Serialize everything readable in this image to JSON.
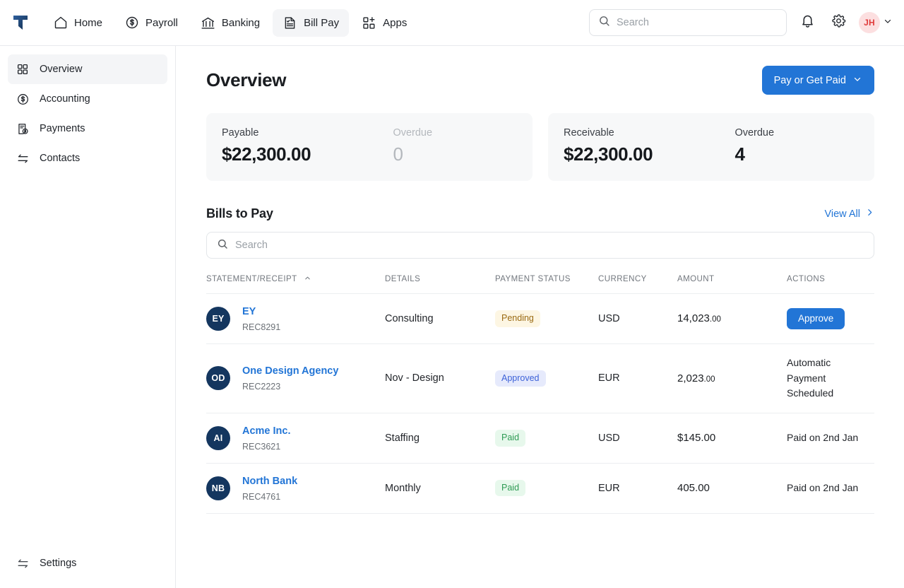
{
  "brand": {
    "logo_alt": "T",
    "primary_color": "#2275d6",
    "logo_color": "#1b3d6b"
  },
  "topnav": {
    "items": [
      {
        "label": "Home",
        "icon": "home-icon",
        "active": false
      },
      {
        "label": "Payroll",
        "icon": "dollar-circle-icon",
        "active": false
      },
      {
        "label": "Banking",
        "icon": "bank-icon",
        "active": false
      },
      {
        "label": "Bill Pay",
        "icon": "document-check-icon",
        "active": true
      },
      {
        "label": "Apps",
        "icon": "apps-plus-icon",
        "active": false
      }
    ],
    "search": {
      "value": "",
      "placeholder": "Search",
      "icon": "search-icon"
    },
    "notifications_icon": "bell-icon",
    "settings_icon": "gear-icon",
    "avatar": {
      "initials": "JH",
      "bg": "#fcdfe0",
      "fg": "#e03b3b",
      "chevron": "chevron-down-icon"
    }
  },
  "sidebar": {
    "items": [
      {
        "label": "Overview",
        "icon": "grid-icon",
        "active": true
      },
      {
        "label": "Accounting",
        "icon": "dollar-circle-icon",
        "active": false
      },
      {
        "label": "Payments",
        "icon": "receipt-dollar-icon",
        "active": false
      },
      {
        "label": "Contacts",
        "icon": "transfer-icon",
        "active": false
      }
    ],
    "bottom": {
      "label": "Settings",
      "icon": "transfer-icon"
    }
  },
  "page": {
    "title": "Overview",
    "primary_action": {
      "label": "Pay or Get Paid",
      "chevron": "chevron-down-icon"
    }
  },
  "cards": [
    {
      "primary_label": "Payable",
      "primary_value": "$22,300.00",
      "secondary_label": "Overdue",
      "secondary_value": "0",
      "secondary_dim": true
    },
    {
      "primary_label": "Receivable",
      "primary_value": "$22,300.00",
      "secondary_label": "Overdue",
      "secondary_value": "4",
      "secondary_dim": false
    }
  ],
  "bills": {
    "section_title": "Bills to Pay",
    "view_all": {
      "label": "View All",
      "icon": "chevron-right-icon"
    },
    "search": {
      "value": "",
      "placeholder": "Search",
      "icon": "search-icon"
    },
    "columns": [
      {
        "key": "name",
        "label": "STATEMENT/RECEIPT",
        "sort": "asc",
        "sort_icon": "chevron-up-icon"
      },
      {
        "key": "details",
        "label": "DETAILS"
      },
      {
        "key": "status",
        "label": "PAYMENT STATUS"
      },
      {
        "key": "currency",
        "label": "CURRENCY"
      },
      {
        "key": "amount",
        "label": "AMOUNT"
      },
      {
        "key": "actions",
        "label": "ACTIONS"
      }
    ],
    "rows": [
      {
        "initials": "EY",
        "name": "EY",
        "reference": "REC8291",
        "details": "Consulting",
        "status": "Pending",
        "status_kind": "pending",
        "currency": "USD",
        "amount_main": "14,023",
        "amount_cents": ".00",
        "amount_small_cents": true,
        "action_type": "button",
        "action_label": "Approve"
      },
      {
        "initials": "OD",
        "name": "One Design Agency",
        "reference": "REC2223",
        "details": "Nov - Design",
        "status": "Approved",
        "status_kind": "approved",
        "currency": "EUR",
        "amount_main": "2,023",
        "amount_cents": ".00",
        "amount_small_cents": true,
        "action_type": "text",
        "action_label": "Automatic Payment Scheduled"
      },
      {
        "initials": "AI",
        "name": "Acme Inc.",
        "reference": "REC3621",
        "details": "Staffing",
        "status": "Paid",
        "status_kind": "paid",
        "currency": "USD",
        "amount_main": "$145.00",
        "amount_cents": "",
        "amount_small_cents": false,
        "action_type": "text",
        "action_label": "Paid on 2nd Jan"
      },
      {
        "initials": "NB",
        "name": "North Bank",
        "reference": "REC4761",
        "details": "Monthly",
        "status": "Paid",
        "status_kind": "paid",
        "currency": "EUR",
        "amount_main": "405.00",
        "amount_cents": "",
        "amount_small_cents": false,
        "action_type": "text",
        "action_label": "Paid on 2nd Jan"
      }
    ]
  }
}
